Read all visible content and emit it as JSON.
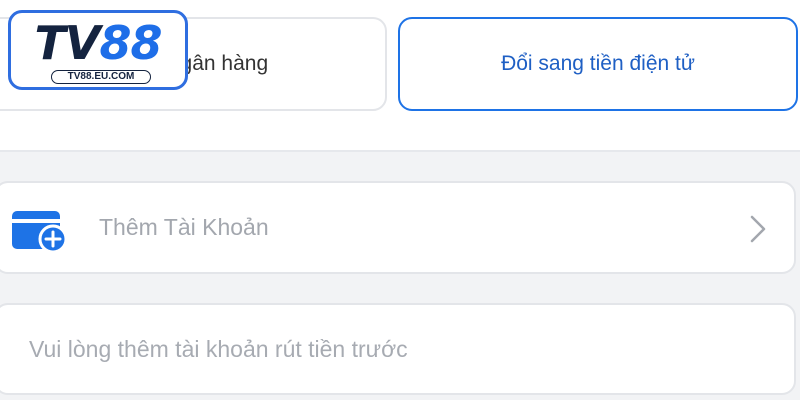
{
  "logo": {
    "brand_letters": "TV",
    "brand_number": "88",
    "domain": "TV88.EU.COM"
  },
  "tabs": [
    {
      "label": "ngân hàng",
      "selected": false
    },
    {
      "label": "Đổi sang tiền điện tử",
      "selected": true
    }
  ],
  "add_account": {
    "label": "Thêm Tài Khoản",
    "icon": "wallet-add-icon",
    "chevron": "chevron-right-icon"
  },
  "notice": {
    "text": "Vui lòng thêm tài khoản rút tiền trước"
  },
  "colors": {
    "accent": "#1e73e6",
    "logo_dark": "#14233f",
    "placeholder": "#a3a7ae",
    "background": "#f2f3f5"
  }
}
